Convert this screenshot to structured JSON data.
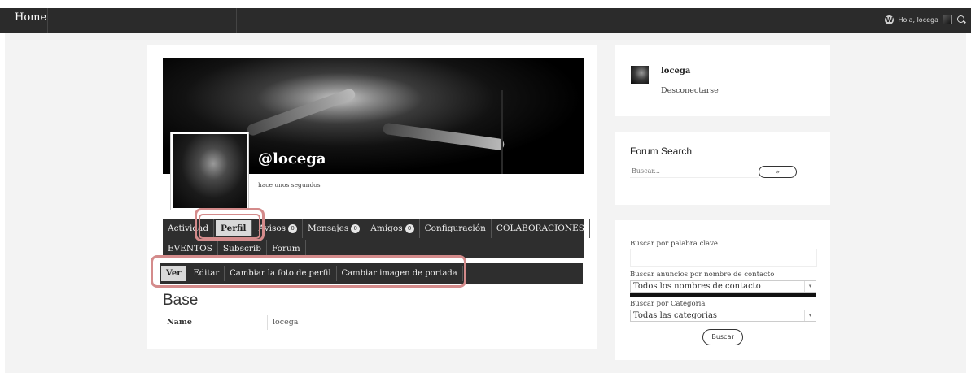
{
  "adminbar": {
    "home_label": "Home",
    "greeting": "Hola, locega",
    "icons": [
      "wordpress-icon",
      "avatar",
      "search-icon"
    ]
  },
  "profile": {
    "username": "@locega",
    "last_active": "hace unos segundos",
    "nav": [
      {
        "label": "Actividad",
        "count": null,
        "active": false
      },
      {
        "label": "Perfil",
        "count": null,
        "active": true
      },
      {
        "label": "Avisos",
        "count": "0",
        "active": false
      },
      {
        "label": "Mensajes",
        "count": "0",
        "active": false
      },
      {
        "label": "Amigos",
        "count": "0",
        "active": false
      },
      {
        "label": "Configuración",
        "count": null,
        "active": false
      },
      {
        "label": "COLABORACIONES",
        "count": null,
        "active": false
      },
      {
        "label": "EVENTOS",
        "count": null,
        "active": false
      },
      {
        "label": "Subscrib",
        "count": null,
        "active": false
      },
      {
        "label": "Forum",
        "count": null,
        "active": false
      }
    ],
    "subnav": [
      {
        "label": "Ver",
        "active": true
      },
      {
        "label": "Editar",
        "active": false
      },
      {
        "label": "Cambiar la foto de perfil",
        "active": false
      },
      {
        "label": "Cambiar imagen de portada",
        "active": false
      }
    ],
    "section_title": "Base",
    "fields": [
      {
        "label": "Name",
        "value": "locega"
      }
    ]
  },
  "sidebar": {
    "user": {
      "name": "locega",
      "logout_label": "Desconectarse"
    },
    "forum_search": {
      "title": "Forum Search",
      "placeholder": "Buscar...",
      "button_label": "»"
    },
    "classifieds": {
      "keyword_label": "Buscar por palabra clave",
      "contact_label": "Buscar anuncios por nombre de contacto",
      "contact_selected": "Todos los nombres de contacto",
      "category_label": "Buscar por Categoria",
      "category_selected": "Todas las categorias",
      "button_label": "Buscar"
    }
  },
  "colors": {
    "adminbar": "#2b2b2b",
    "nav": "#2e2e2e",
    "highlight": "#d48b8b",
    "page_bg": "#f3f3f3"
  }
}
